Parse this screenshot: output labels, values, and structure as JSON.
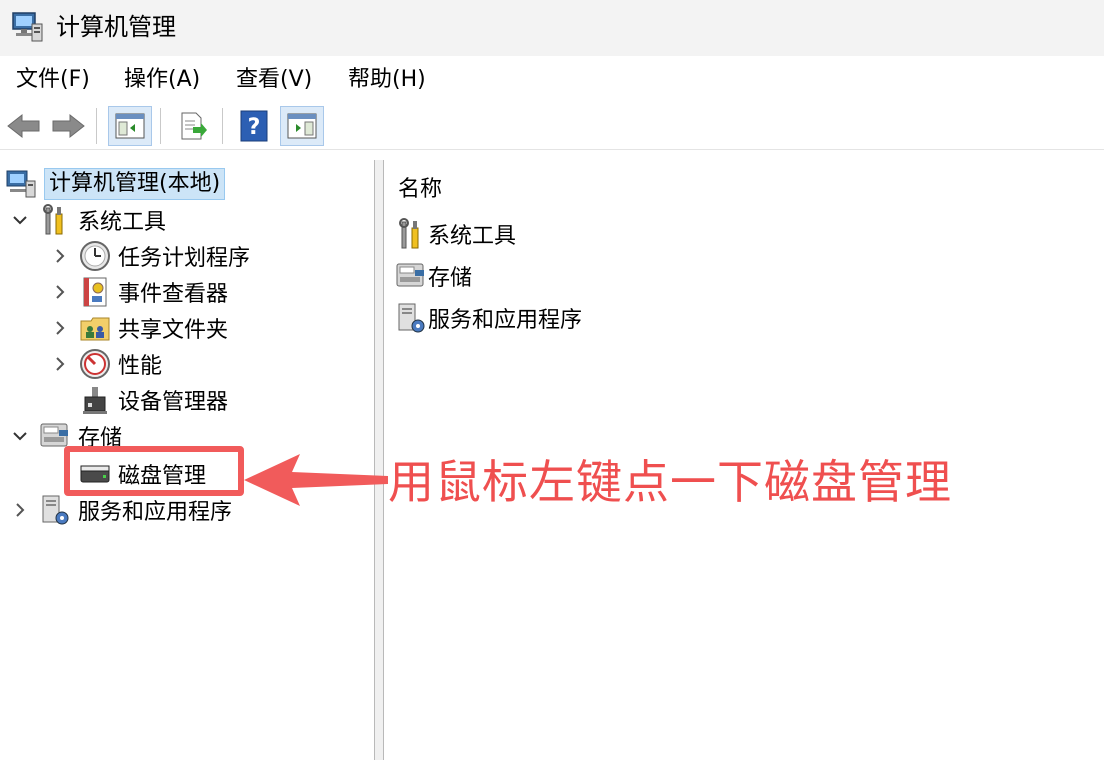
{
  "window": {
    "title": "计算机管理"
  },
  "menu": [
    {
      "label": "文件(F)"
    },
    {
      "label": "操作(A)"
    },
    {
      "label": "查看(V)"
    },
    {
      "label": "帮助(H)"
    }
  ],
  "toolbar": {
    "buttons": [
      "back-icon",
      "forward-icon",
      "show-hide-console-tree-icon",
      "export-list-icon",
      "help-icon",
      "show-hide-action-pane-icon"
    ]
  },
  "tree": {
    "root": {
      "label": "计算机管理(本地)",
      "icon": "computer-management-icon"
    },
    "items": [
      {
        "label": "系统工具",
        "icon": "tools-icon",
        "expander": "expanded"
      },
      {
        "label": "任务计划程序",
        "icon": "clock-icon",
        "expander": "collapsed"
      },
      {
        "label": "事件查看器",
        "icon": "event-viewer-icon",
        "expander": "collapsed"
      },
      {
        "label": "共享文件夹",
        "icon": "shared-folder-icon",
        "expander": "collapsed"
      },
      {
        "label": "性能",
        "icon": "performance-icon",
        "expander": "collapsed"
      },
      {
        "label": "设备管理器",
        "icon": "device-manager-icon",
        "expander": "none"
      },
      {
        "label": "存储",
        "icon": "storage-icon",
        "expander": "expanded"
      },
      {
        "label": "磁盘管理",
        "icon": "disk-icon",
        "expander": "none"
      },
      {
        "label": "服务和应用程序",
        "icon": "services-icon",
        "expander": "collapsed"
      }
    ]
  },
  "list": {
    "column_header": "名称",
    "rows": [
      {
        "label": "系统工具",
        "icon": "tools-icon"
      },
      {
        "label": "存储",
        "icon": "storage-icon"
      },
      {
        "label": "服务和应用程序",
        "icon": "services-icon"
      }
    ]
  },
  "annotation": {
    "text": "用鼠标左键点一下磁盘管理",
    "color": "#ef4f4f"
  },
  "colors": {
    "selection_bg": "#cce4f7",
    "selection_border": "#99c9ef",
    "annotation_red": "#f15b5b"
  }
}
